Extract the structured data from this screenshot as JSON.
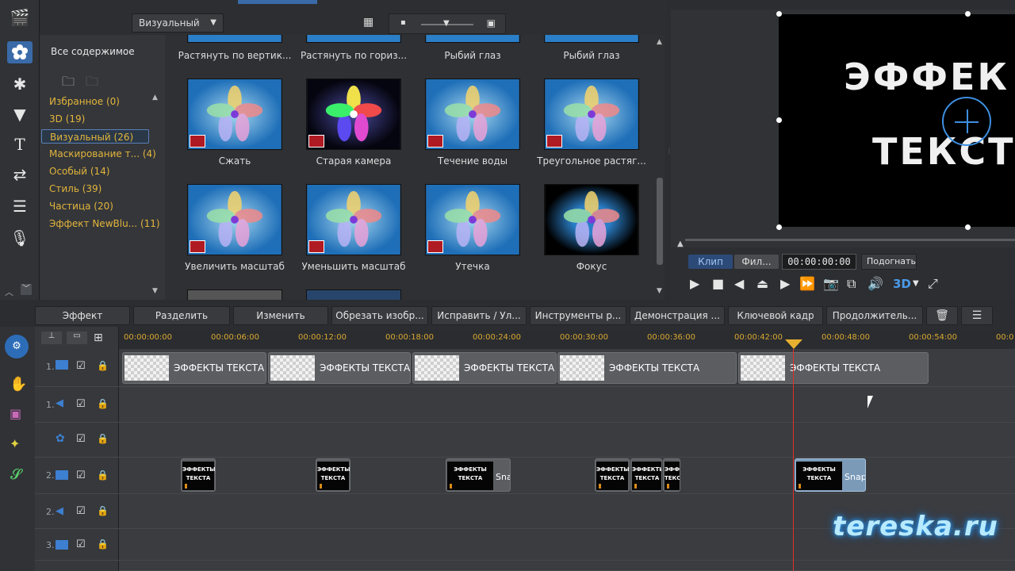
{
  "library": {
    "filter_dropdown": "Визуальный",
    "all_content": "Все содержимое",
    "categories": [
      {
        "label": "Избранное  (0)"
      },
      {
        "label": "3D  (19)"
      },
      {
        "label": "Визуальный  (26)"
      },
      {
        "label": "Маскирование т...  (4)"
      },
      {
        "label": "Особый  (14)"
      },
      {
        "label": "Стиль  (39)"
      },
      {
        "label": "Частица  (20)"
      },
      {
        "label": "Эффект NewBlu...  (11)"
      }
    ],
    "top_row_labels": [
      "Растянуть по вертик...",
      "Растянуть по гориз...",
      "Рыбий глаз",
      "Рыбий глаз"
    ],
    "row1_labels": [
      "Сжать",
      "Старая камера",
      "Течение воды",
      "Треугольное растяг..."
    ],
    "row2_labels": [
      "Увеличить масштаб",
      "Уменьшить масштаб",
      "Утечка",
      "Фокус"
    ]
  },
  "preview": {
    "text_line1": "ЭФФЕК",
    "text_line2": "ТЕКСТ",
    "tab_clip": "Клип",
    "tab_film": "Фил...",
    "timecode": "00:00:00:00",
    "fit_label": "Подогнать",
    "mode_3d": "3D"
  },
  "toolbar": {
    "effect": "Эффект",
    "split": "Разделить",
    "modify": "Изменить",
    "crop": "Обрезать изобр...",
    "fix": "Исправить / Ул...",
    "tools": "Инструменты р...",
    "demo": "Демонстрация ...",
    "keyframe": "Ключевой кадр",
    "duration": "Продолжитель..."
  },
  "timeline": {
    "ruler_ticks": [
      "00:00:00:00",
      "00:00:06:00",
      "00:00:12:00",
      "00:00:18:00",
      "00:00:24:00",
      "00:00:30:00",
      "00:00:36:00",
      "00:00:42:00",
      "00:00:48:00",
      "00:00:54:00",
      "00:0"
    ],
    "tracks": [
      "1.",
      "1.",
      "",
      "2.",
      "2.",
      "3."
    ],
    "title_clip_label": "ЭФФЕКТЫ  ТЕКСТА",
    "video_thumb_text": "ЭФФЕКТЫ ТЕКСТА",
    "snap_label": "Snap"
  },
  "watermark": "tereska.ru",
  "colors": {
    "accent": "#3a6aa8",
    "category_text": "#e3b53b",
    "playhead": "#e0302a"
  }
}
